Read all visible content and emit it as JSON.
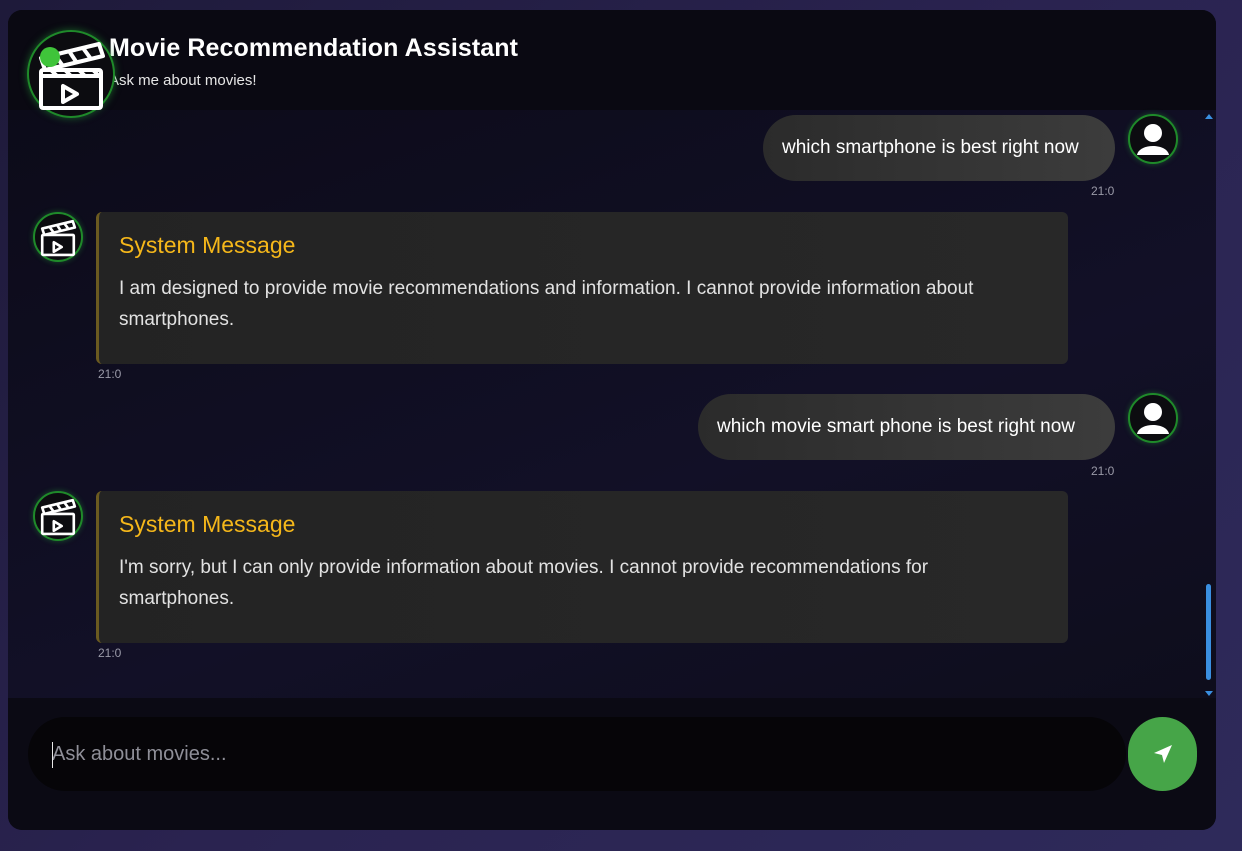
{
  "header": {
    "title": "Movie Recommendation Assistant",
    "subtitle": "Ask me about movies!",
    "avatar_icon": "clapperboard-icon",
    "status": "online"
  },
  "messages": [
    {
      "role": "user",
      "text": "which smartphone is best right now",
      "time": "21:0"
    },
    {
      "role": "bot",
      "title": "System Message",
      "text": "I am designed to provide movie recommendations and information. I cannot provide information about smartphones.",
      "time": "21:0"
    },
    {
      "role": "user",
      "text": "which movie smart phone is best right now",
      "time": "21:0"
    },
    {
      "role": "bot",
      "title": "System Message",
      "text": "I'm sorry, but I can only provide information about movies. I cannot provide recommendations for smartphones.",
      "time": "21:0"
    }
  ],
  "composer": {
    "placeholder": "Ask about movies...",
    "value": "",
    "send_icon": "send-icon"
  },
  "colors": {
    "accent_green": "#46a548",
    "system_title": "#f5b71a",
    "scrollbar": "#3a8fe0"
  }
}
